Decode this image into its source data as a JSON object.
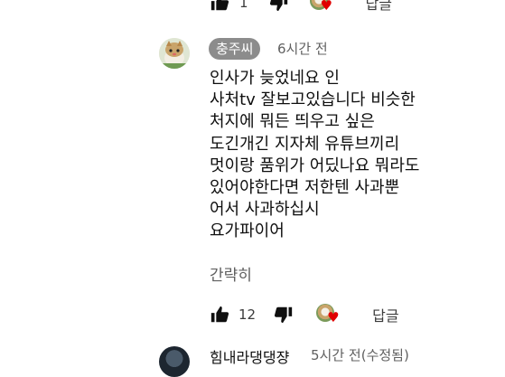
{
  "prev_comment_actions": {
    "like_count": "1",
    "reply_label": "답글"
  },
  "comment": {
    "author": "충주씨",
    "timestamp": "6시간 전",
    "body_lines": [
      "인사가 늦었네요 인",
      "사처tv 잘보고있습니다 비슷한",
      "처지에 뭐든 띄우고 싶은",
      "도긴개긴 지자체 유튜브끼리",
      "멋이랑 품위가 어딨나요 뭐라도",
      "있어야한다면 저한텐 사과뿐",
      "어서 사과하십시",
      "요가파이어"
    ],
    "show_less_label": "간략히",
    "like_count": "12",
    "reply_label": "답글"
  },
  "next_comment": {
    "author": "힘내라댕댕쟝",
    "timestamp": "5시간 전(수정됨)"
  },
  "colors": {
    "heart": "#e00000",
    "author_chip_bg": "#8c8c8c",
    "secondary_text": "#606060"
  },
  "icons": {
    "like": "thumbs-up-icon",
    "dislike": "thumbs-down-icon",
    "creator_heart": "creator-heart-icon"
  }
}
